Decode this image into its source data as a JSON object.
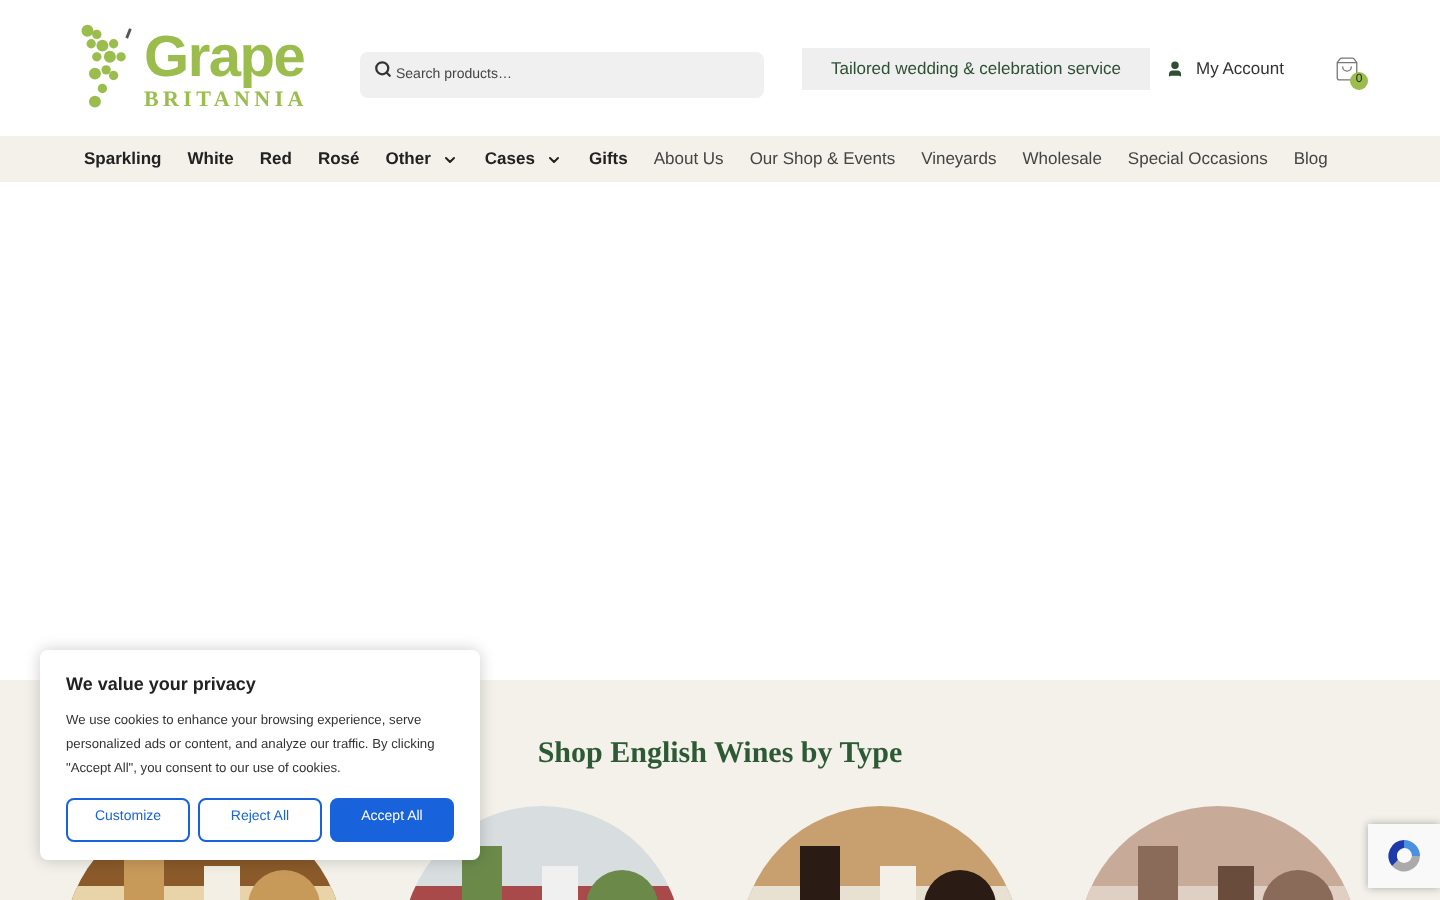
{
  "logo": {
    "title": "Grape",
    "subtitle": "BRITANNIA"
  },
  "search": {
    "placeholder": "Search products…"
  },
  "promo": "Tailored wedding & celebration service",
  "account": "My Account",
  "cart": {
    "count": "0"
  },
  "nav": [
    {
      "label": "Sparkling",
      "kind": "category",
      "dropdown": false
    },
    {
      "label": "White",
      "kind": "category",
      "dropdown": false
    },
    {
      "label": "Red",
      "kind": "category",
      "dropdown": false
    },
    {
      "label": "Rosé",
      "kind": "category",
      "dropdown": false
    },
    {
      "label": "Other",
      "kind": "category",
      "dropdown": true
    },
    {
      "label": "Cases",
      "kind": "category",
      "dropdown": true
    },
    {
      "label": "Gifts",
      "kind": "category",
      "dropdown": false
    },
    {
      "label": "About Us",
      "kind": "page",
      "dropdown": false
    },
    {
      "label": "Our Shop & Events",
      "kind": "page",
      "dropdown": false
    },
    {
      "label": "Vineyards",
      "kind": "page",
      "dropdown": false
    },
    {
      "label": "Wholesale",
      "kind": "page",
      "dropdown": false
    },
    {
      "label": "Special Occasions",
      "kind": "page",
      "dropdown": false
    },
    {
      "label": "Blog",
      "kind": "page",
      "dropdown": false
    }
  ],
  "section": {
    "heading": "Shop English Wines by Type"
  },
  "cookie": {
    "title": "We value your privacy",
    "text": "We use cookies to enhance your browsing experience, serve personalized ads or content, and analyze our traffic. By clicking \"Accept All\", you consent to our use of cookies.",
    "buttons": [
      {
        "label": "Customize",
        "kind": "outline"
      },
      {
        "label": "Reject All",
        "kind": "outline"
      },
      {
        "label": "Accept All",
        "kind": "primary"
      }
    ]
  }
}
